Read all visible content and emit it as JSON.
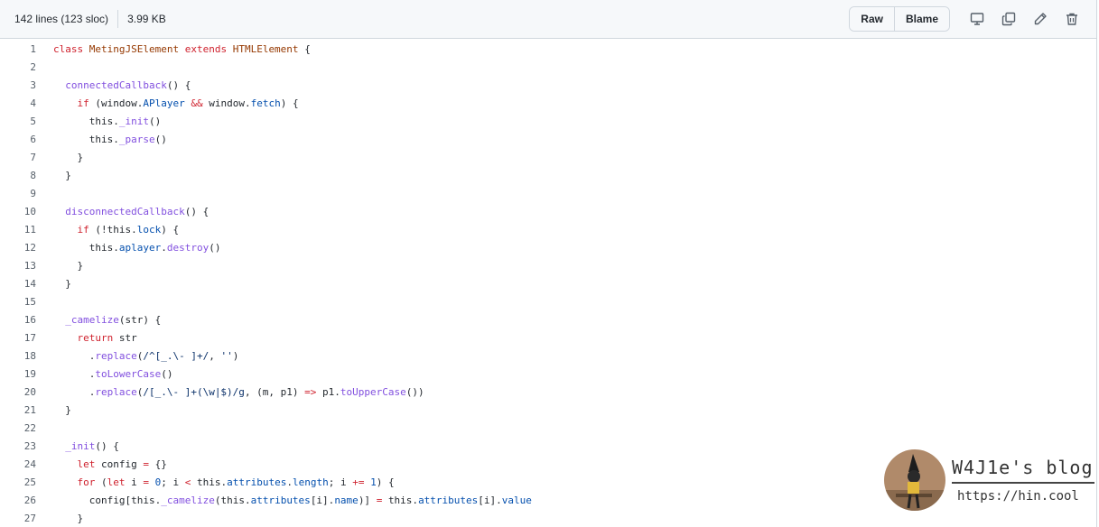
{
  "file_info": {
    "lines": "142 lines (123 sloc)",
    "size": "3.99 KB"
  },
  "toolbar": {
    "raw_label": "Raw",
    "blame_label": "Blame",
    "icons": [
      "desktop-icon",
      "copy-icon",
      "pencil-icon",
      "trash-icon"
    ]
  },
  "code_lines": [
    {
      "n": "1",
      "tokens": [
        [
          "k",
          "class "
        ],
        [
          "t",
          "MetingJSElement "
        ],
        [
          "k",
          "extends "
        ],
        [
          "t",
          "HTMLElement "
        ],
        [
          "",
          "{"
        ]
      ]
    },
    {
      "n": "2",
      "tokens": []
    },
    {
      "n": "3",
      "tokens": [
        [
          "",
          "  "
        ],
        [
          "f",
          "connectedCallback"
        ],
        [
          "",
          "() {"
        ]
      ]
    },
    {
      "n": "4",
      "tokens": [
        [
          "",
          "    "
        ],
        [
          "k",
          "if "
        ],
        [
          "",
          "(window."
        ],
        [
          "p",
          "APlayer "
        ],
        [
          "k",
          "&& "
        ],
        [
          "",
          "window."
        ],
        [
          "p",
          "fetch"
        ],
        [
          "",
          ") {"
        ]
      ]
    },
    {
      "n": "5",
      "tokens": [
        [
          "",
          "      this."
        ],
        [
          "f",
          "_init"
        ],
        [
          "",
          "()"
        ]
      ]
    },
    {
      "n": "6",
      "tokens": [
        [
          "",
          "      this."
        ],
        [
          "f",
          "_parse"
        ],
        [
          "",
          "()"
        ]
      ]
    },
    {
      "n": "7",
      "tokens": [
        [
          "",
          "    }"
        ]
      ]
    },
    {
      "n": "8",
      "tokens": [
        [
          "",
          "  }"
        ]
      ]
    },
    {
      "n": "9",
      "tokens": []
    },
    {
      "n": "10",
      "tokens": [
        [
          "",
          "  "
        ],
        [
          "f",
          "disconnectedCallback"
        ],
        [
          "",
          "() {"
        ]
      ]
    },
    {
      "n": "11",
      "tokens": [
        [
          "",
          "    "
        ],
        [
          "k",
          "if "
        ],
        [
          "",
          "(!this."
        ],
        [
          "p",
          "lock"
        ],
        [
          "",
          ") {"
        ]
      ]
    },
    {
      "n": "12",
      "tokens": [
        [
          "",
          "      this."
        ],
        [
          "p",
          "aplayer"
        ],
        [
          "",
          "."
        ],
        [
          "f",
          "destroy"
        ],
        [
          "",
          "()"
        ]
      ]
    },
    {
      "n": "13",
      "tokens": [
        [
          "",
          "    }"
        ]
      ]
    },
    {
      "n": "14",
      "tokens": [
        [
          "",
          "  }"
        ]
      ]
    },
    {
      "n": "15",
      "tokens": []
    },
    {
      "n": "16",
      "tokens": [
        [
          "",
          "  "
        ],
        [
          "f",
          "_camelize"
        ],
        [
          "",
          "(str) {"
        ]
      ]
    },
    {
      "n": "17",
      "tokens": [
        [
          "",
          "    "
        ],
        [
          "k",
          "return "
        ],
        [
          "",
          "str"
        ]
      ]
    },
    {
      "n": "18",
      "tokens": [
        [
          "",
          "      ."
        ],
        [
          "f",
          "replace"
        ],
        [
          "",
          "("
        ],
        [
          "s",
          "/^[_.\\- ]+/"
        ],
        [
          "",
          ", "
        ],
        [
          "s",
          "''"
        ],
        [
          "",
          ")"
        ]
      ]
    },
    {
      "n": "19",
      "tokens": [
        [
          "",
          "      ."
        ],
        [
          "f",
          "toLowerCase"
        ],
        [
          "",
          "()"
        ]
      ]
    },
    {
      "n": "20",
      "tokens": [
        [
          "",
          "      ."
        ],
        [
          "f",
          "replace"
        ],
        [
          "",
          "("
        ],
        [
          "s",
          "/[_.\\- ]+(\\w|$)/g"
        ],
        [
          "",
          ", (m, p1) "
        ],
        [
          "k",
          "=> "
        ],
        [
          "",
          "p1."
        ],
        [
          "f",
          "toUpperCase"
        ],
        [
          "",
          "())"
        ]
      ]
    },
    {
      "n": "21",
      "tokens": [
        [
          "",
          "  }"
        ]
      ]
    },
    {
      "n": "22",
      "tokens": []
    },
    {
      "n": "23",
      "tokens": [
        [
          "",
          "  "
        ],
        [
          "f",
          "_init"
        ],
        [
          "",
          "() {"
        ]
      ]
    },
    {
      "n": "24",
      "tokens": [
        [
          "",
          "    "
        ],
        [
          "k",
          "let "
        ],
        [
          "",
          "config "
        ],
        [
          "k",
          "= "
        ],
        [
          "",
          "{}"
        ]
      ]
    },
    {
      "n": "25",
      "tokens": [
        [
          "",
          "    "
        ],
        [
          "k",
          "for "
        ],
        [
          "",
          "("
        ],
        [
          "k",
          "let "
        ],
        [
          "",
          "i "
        ],
        [
          "k",
          "= "
        ],
        [
          "p",
          "0"
        ],
        [
          "",
          "; i "
        ],
        [
          "k",
          "< "
        ],
        [
          "",
          "this."
        ],
        [
          "p",
          "attributes"
        ],
        [
          "",
          "."
        ],
        [
          "p",
          "length"
        ],
        [
          "",
          "; i "
        ],
        [
          "k",
          "+= "
        ],
        [
          "p",
          "1"
        ],
        [
          "",
          ") {"
        ]
      ]
    },
    {
      "n": "26",
      "tokens": [
        [
          "",
          "      config[this."
        ],
        [
          "f",
          "_camelize"
        ],
        [
          "",
          "(this."
        ],
        [
          "p",
          "attributes"
        ],
        [
          "",
          "[i]."
        ],
        [
          "p",
          "name"
        ],
        [
          "",
          ")] "
        ],
        [
          "k",
          "= "
        ],
        [
          "",
          "this."
        ],
        [
          "p",
          "attributes"
        ],
        [
          "",
          "[i]."
        ],
        [
          "p",
          "value"
        ]
      ]
    },
    {
      "n": "27",
      "tokens": [
        [
          "",
          "    }"
        ]
      ]
    }
  ],
  "watermark": {
    "title": "W4J1e's blog",
    "url": "https://hin.cool"
  },
  "colors": {
    "keyword": "#cf222e",
    "type": "#953800",
    "function": "#8250df",
    "property": "#0550ae",
    "string": "#0a3069",
    "line_number": "#57606a"
  }
}
